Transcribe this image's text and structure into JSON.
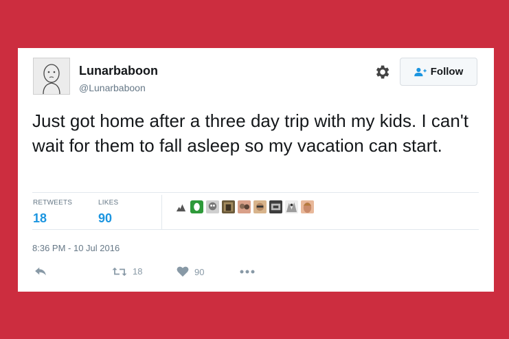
{
  "tweet": {
    "display_name": "Lunarbaboon",
    "handle": "@Lunarbaboon",
    "follow_label": "Follow",
    "text": "Just got home after a three day trip with my kids. I can't wait for them to fall asleep so my vacation can start.",
    "retweets_label": "RETWEETS",
    "retweets_count": "18",
    "likes_label": "LIKES",
    "likes_count": "90",
    "timestamp": "8:36 PM - 10 Jul 2016",
    "retweet_action_count": "18",
    "like_action_count": "90"
  },
  "icons": {
    "settings": "gear-icon",
    "follow": "add-user-icon",
    "reply": "reply-icon",
    "retweet": "retweet-icon",
    "like": "heart-icon",
    "more": "more-dots-icon"
  },
  "likers": [
    {
      "color": "#555555"
    },
    {
      "color": "#2e9a3a"
    },
    {
      "color": "#777777"
    },
    {
      "color": "#6b5a3a"
    },
    {
      "color": "#8a6a55"
    },
    {
      "color": "#b88c66"
    },
    {
      "color": "#3d3d3d"
    },
    {
      "color": "#9c9c9c"
    },
    {
      "color": "#c98a6a"
    }
  ],
  "colors": {
    "background": "#cc2d3f",
    "card": "#ffffff",
    "link_blue": "#1b95e0",
    "muted": "#657786"
  }
}
